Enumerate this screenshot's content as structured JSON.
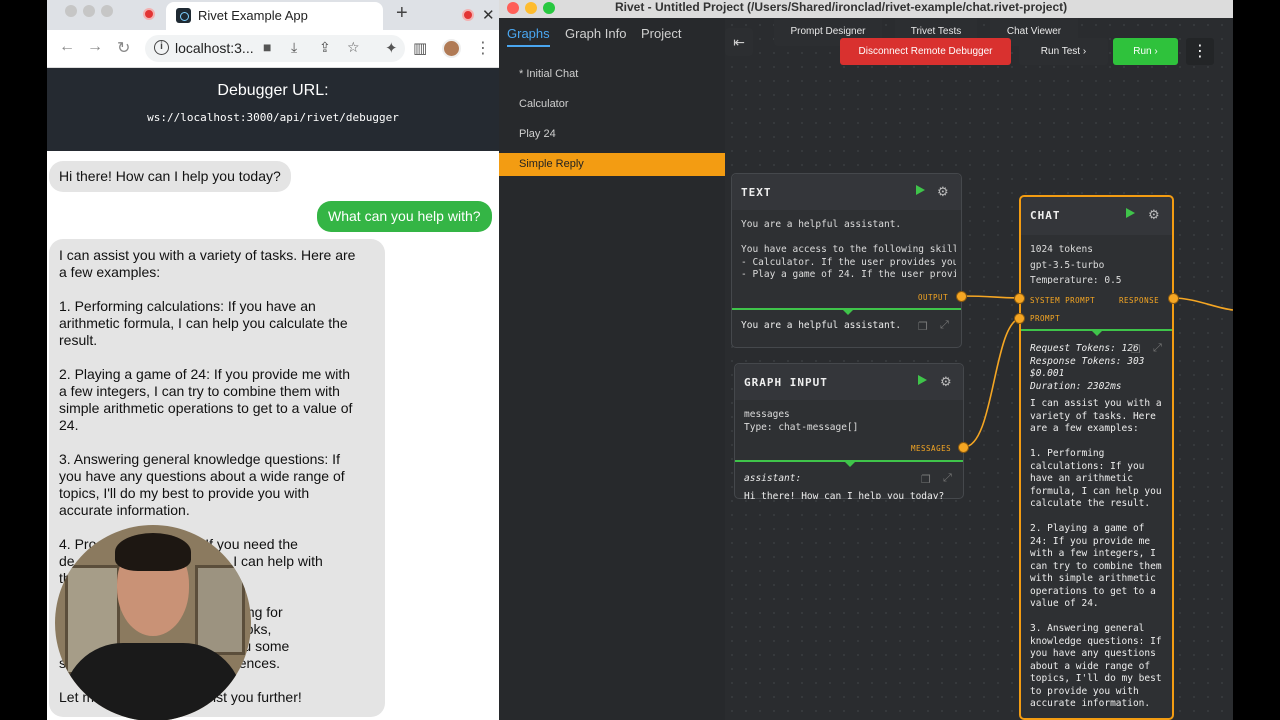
{
  "browser": {
    "tab_title": "Rivet Example App",
    "url": "localhost:3...",
    "banner": {
      "title": "Debugger URL:",
      "url": "ws://localhost:3000/api/rivet/debugger"
    },
    "messages": [
      {
        "role": "assistant",
        "text": "Hi there! How can I help you today?"
      },
      {
        "role": "user",
        "text": "What can you help with?"
      },
      {
        "role": "assistant",
        "text": "I can assist you with a variety of tasks. Here are\na few examples:\n\n1. Performing calculations: If you have an\narithmetic formula, I can help you calculate the\nresult.\n\n2. Playing a game of 24: If you provide me with\na few integers, I can try to combine them with\nsimple arithmetic operations to get to a value of\n24.\n\n3. Answering general knowledge questions: If\nyou have any questions about a wide range of\ntopics, I'll do my best to provide you with\naccurate information.\n\n4. Pro                            If you need the\nde                                   se, I can help with\nth\n\n                                    're looking for\n                                    s for books,\n                                    give you some\ns                                   preferences.\n\nLet m                         assist you further!"
      }
    ]
  },
  "rivet": {
    "window_title": "Rivet - Untitled Project (/Users/Shared/ironclad/rivet-example/chat.rivet-project)",
    "sidebar_tabs": [
      "Graphs",
      "Graph Info",
      "Project"
    ],
    "graphs": [
      "* Initial Chat",
      "Calculator",
      "Play 24",
      "Simple Reply"
    ],
    "active_graph": "Simple Reply",
    "top_tabs": [
      "Prompt Designer",
      "Trivet Tests",
      "Chat Viewer"
    ],
    "buttons": {
      "disconnect": "Disconnect Remote Debugger",
      "run_test": "Run Test",
      "run": "Run"
    },
    "nodes": {
      "text": {
        "title": "TEXT",
        "body": "You are a helpful assistant.\n\nYou have access to the following skill\n- Calculator. If the user provides you\n- Play a game of 24. If the user provi",
        "port_output": "OUTPUT",
        "output": "You are a helpful assistant."
      },
      "graph_input": {
        "title": "GRAPH INPUT",
        "body": "messages\nType: chat-message[]",
        "port_messages": "MESSAGES",
        "output_role": "assistant:",
        "output": "Hi there! How can I help you today?"
      },
      "chat": {
        "title": "CHAT",
        "body": "1024 tokens\ngpt-3.5-turbo\nTemperature: 0.5",
        "port_system": "SYSTEM PROMPT",
        "port_prompt": "PROMPT",
        "port_response": "RESPONSE",
        "stats": "Request Tokens: 126\nResponse Tokens: 303\n$0.001\nDuration: 2302ms",
        "output": "I can assist you with a\nvariety of tasks. Here\nare a few examples:\n\n1. Performing\ncalculations: If you\nhave an arithmetic\nformula, I can help you\ncalculate the result.\n\n2. Playing a game of\n24: If you provide me\nwith a few integers, I\ncan try to combine them\nwith simple arithmetic\noperations to get to a\nvalue of 24.\n\n3. Answering general\nknowledge questions: If\nyou have any questions\nabout a wide range of\ntopics, I'll do my best\nto provide you with\naccurate information."
      }
    }
  },
  "icons": {
    "back": "arrow-left-icon",
    "forward": "arrow-right-icon",
    "reload": "reload-icon",
    "info": "info-icon",
    "play": "play-icon",
    "gear": "gear-icon",
    "copy": "copy-icon",
    "expand": "expand-icon"
  },
  "colors": {
    "accent_orange": "#f39c12",
    "green": "#3fc44a",
    "red_button": "#d9312f",
    "tab_blue": "#4aa6f0"
  }
}
